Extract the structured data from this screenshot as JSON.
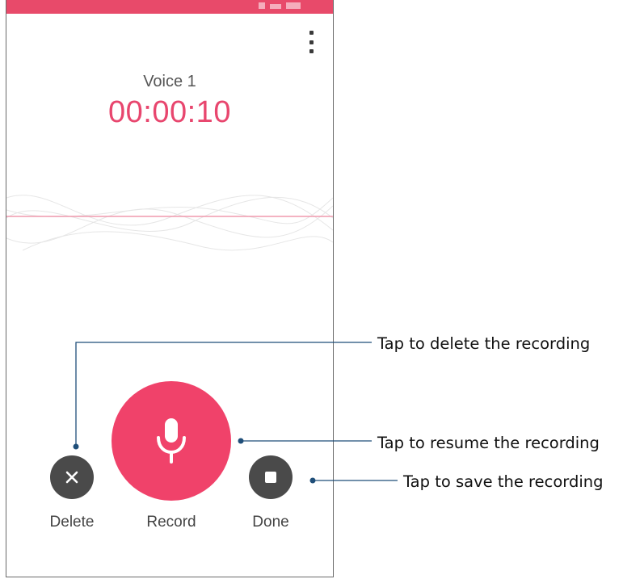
{
  "recording": {
    "name": "Voice 1",
    "elapsed": "00:00:10"
  },
  "buttons": {
    "delete_label": "Delete",
    "record_label": "Record",
    "done_label": "Done"
  },
  "icons": {
    "menu": "more-vert-icon",
    "delete": "close-icon",
    "record": "microphone-icon",
    "done": "stop-icon"
  },
  "callouts": {
    "delete": "Tap to delete the recording",
    "resume": "Tap to resume the recording",
    "save": "Tap to save the recording"
  },
  "colors": {
    "accent": "#f0426a",
    "timer": "#e8466e",
    "status_bar": "#e84a6a",
    "dark_button": "#4a4a4a",
    "callout_line": "#1f4e79"
  }
}
